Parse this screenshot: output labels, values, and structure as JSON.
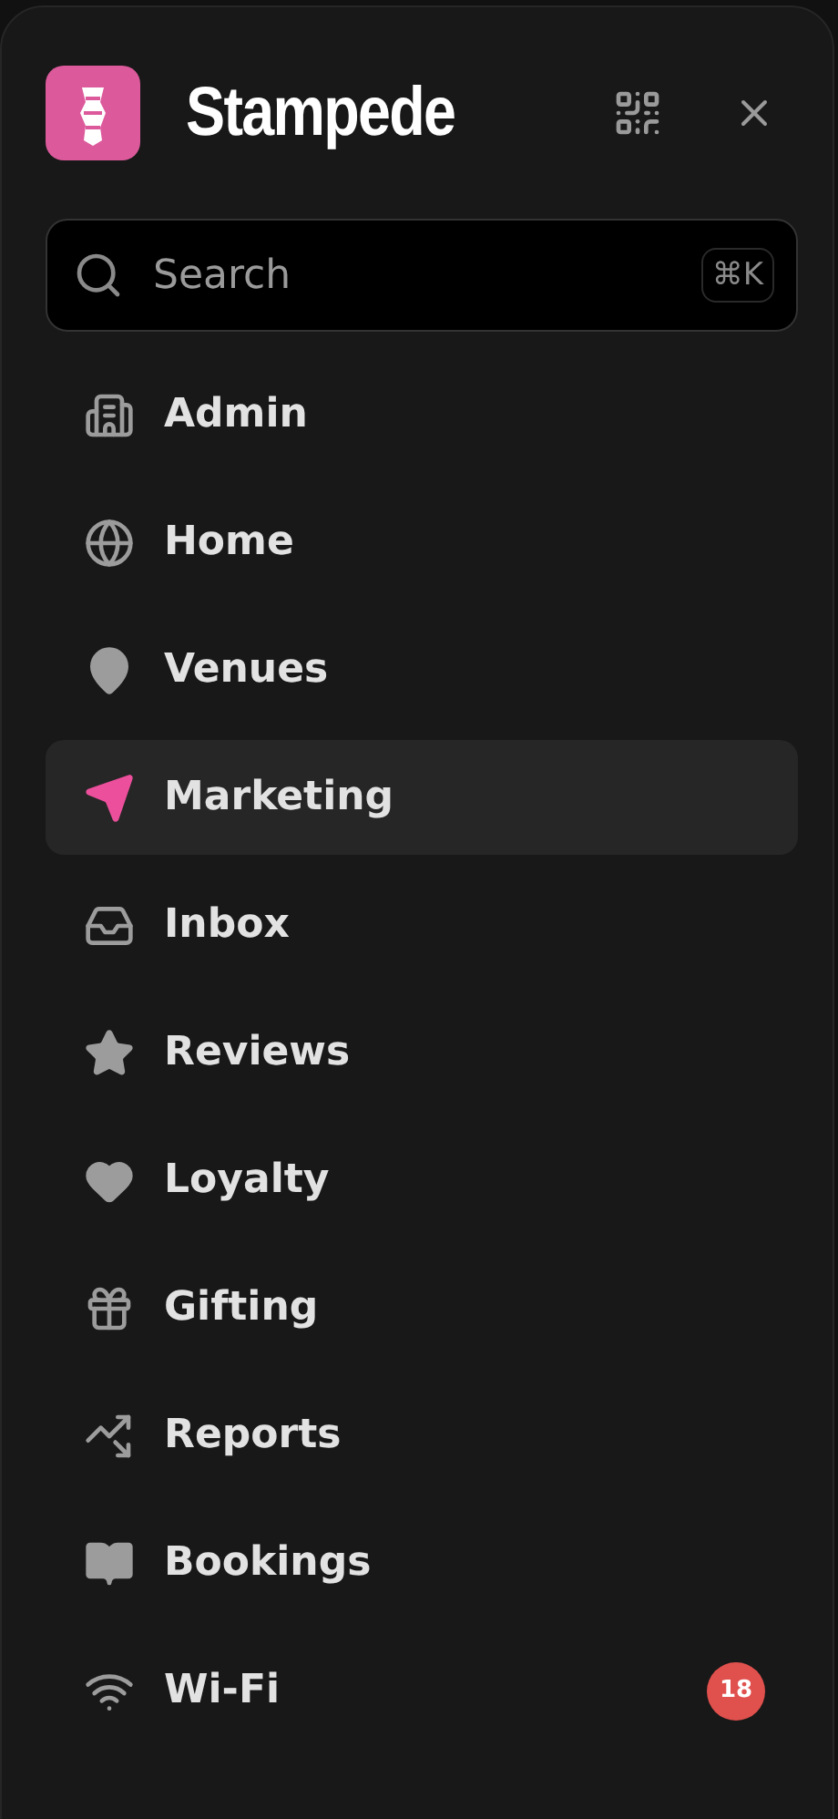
{
  "brand": {
    "title": "Stampede"
  },
  "search": {
    "placeholder": "Search",
    "shortcut": "⌘K"
  },
  "nav": [
    {
      "label": "Admin",
      "selected": false
    },
    {
      "label": "Home",
      "selected": false
    },
    {
      "label": "Venues",
      "selected": false
    },
    {
      "label": "Marketing",
      "selected": true
    },
    {
      "label": "Inbox",
      "selected": false
    },
    {
      "label": "Reviews",
      "selected": false
    },
    {
      "label": "Loyalty",
      "selected": false
    },
    {
      "label": "Gifting",
      "selected": false
    },
    {
      "label": "Reports",
      "selected": false
    },
    {
      "label": "Bookings",
      "selected": false
    },
    {
      "label": "Wi-Fi",
      "selected": false,
      "badge": "18"
    }
  ]
}
